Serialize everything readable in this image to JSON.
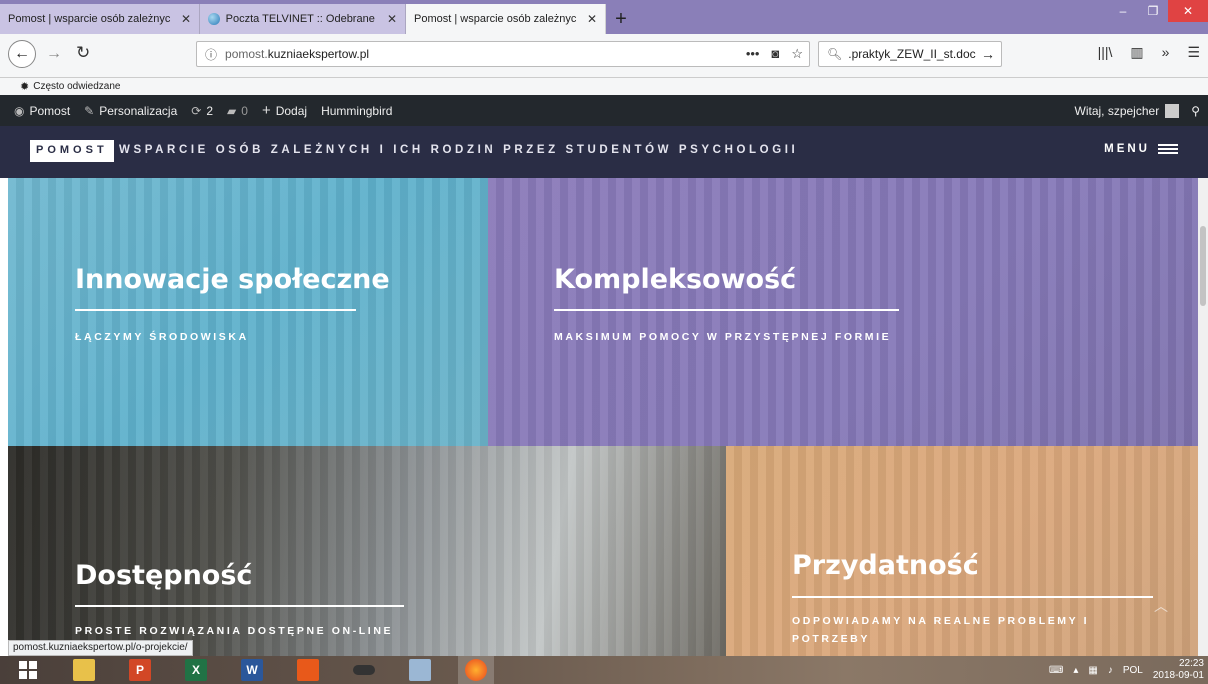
{
  "browser": {
    "tabs": [
      {
        "label": "Pomost | wsparcie osób zależnych i",
        "close": "✕",
        "state": "bg"
      },
      {
        "label": "Poczta TELVINET :: Odebrane",
        "close": "✕",
        "state": "bg"
      },
      {
        "label": "Pomost | wsparcie osób zależnych i",
        "close": "✕",
        "state": "active"
      }
    ],
    "new_tab": "+",
    "url_host": "pomost.",
    "url_domain": "kuzniaekspertow.pl",
    "search_text": ".praktyk_ZEW_II_st.doc",
    "bookmark": "Często odwiedzane"
  },
  "wpbar": {
    "site": "Pomost",
    "customize": "Personalizacja",
    "updates": "2",
    "comments": "0",
    "add": "Dodaj",
    "plugin": "Hummingbird",
    "greeting": "Witaj, szpejcher"
  },
  "site": {
    "logo": "POMOST",
    "tagline": "WSPARCIE OSÓB ZALEŻNYCH I ICH RODZIN PRZEZ STUDENTÓW PSYCHOLOGII",
    "menu": "MENU"
  },
  "panels": [
    {
      "title": "Innowacje społeczne",
      "subtitle": "ŁĄCZYMY ŚRODOWISKA"
    },
    {
      "title": "Kompleksowość",
      "subtitle": "MAKSIMUM POMOCY W PRZYSTĘPNEJ FORMIE"
    },
    {
      "title": "Dostępność",
      "subtitle": "PROSTE ROZWIĄZANIA DOSTĘPNE ON-LINE"
    },
    {
      "title": "Przydatność",
      "subtitle": "ODPOWIADAMY NA REALNE PROBLEMY I POTRZEBY"
    }
  ],
  "status_link": "pomost.kuzniaekspertow.pl/o-projekcie/",
  "taskbar": {
    "lang": "POL",
    "time": "22:23",
    "date": "2018-09-01"
  },
  "colors": {
    "panel_blue": "#5fb1cc",
    "panel_purple": "#8679b8",
    "panel_tan": "#dba87c",
    "header_navy": "#2a2d45",
    "wpbar": "#23282d"
  }
}
